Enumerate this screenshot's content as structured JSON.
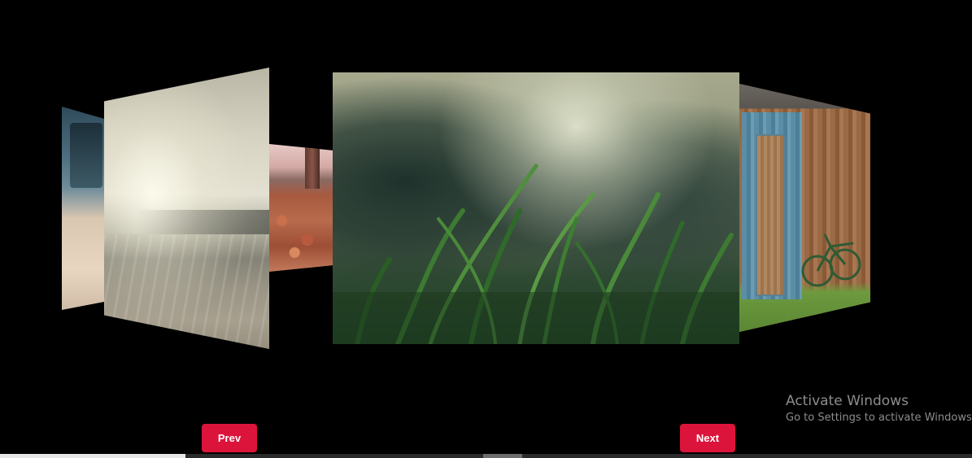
{
  "carousel": {
    "slides": [
      {
        "id": "slide-far-left",
        "subject": "beach-road-car"
      },
      {
        "id": "slide-left",
        "subject": "hazy-beach"
      },
      {
        "id": "slide-small",
        "subject": "autumn-leaves"
      },
      {
        "id": "slide-center",
        "subject": "grass-closeup"
      },
      {
        "id": "slide-right",
        "subject": "barn-door-bicycle"
      }
    ]
  },
  "controls": {
    "prev_label": "Prev",
    "next_label": "Next",
    "accent_color": "#dc143c"
  },
  "watermark": {
    "title": "Activate Windows",
    "subtitle": "Go to Settings to activate Windows."
  },
  "colors": {
    "background": "#000000",
    "button_text": "#ffffff",
    "watermark_text": "#8d8d8d"
  }
}
